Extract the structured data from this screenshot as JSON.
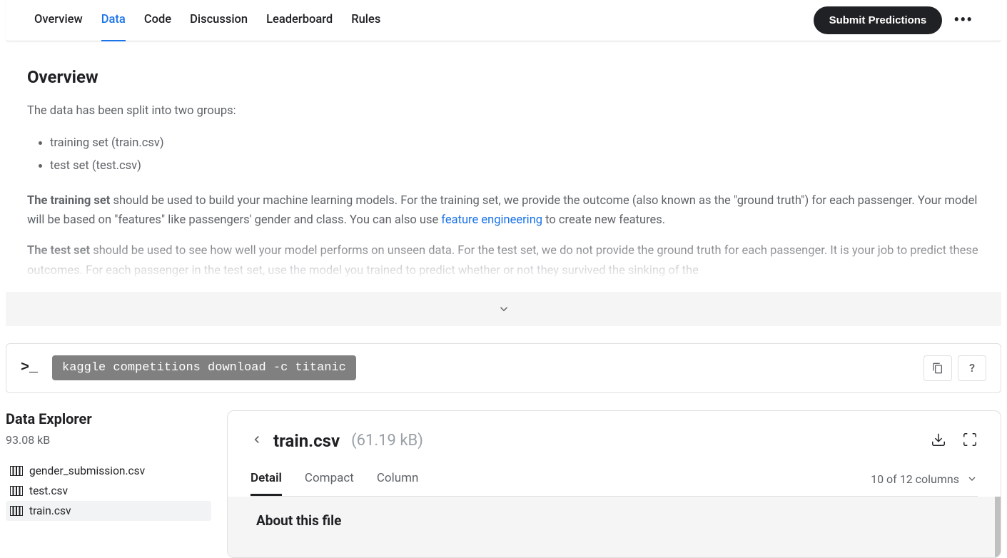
{
  "tabs": {
    "overview": "Overview",
    "data": "Data",
    "code": "Code",
    "discussion": "Discussion",
    "leaderboard": "Leaderboard",
    "rules": "Rules"
  },
  "submit_label": "Submit Predictions",
  "overview": {
    "heading": "Overview",
    "intro": "The data has been split into two groups:",
    "bullets": {
      "b0": "training set (train.csv)",
      "b1": "test set (test.csv)"
    },
    "para1_strong": "The training set",
    "para1_rest_a": " should be used to build your machine learning models. For the training set, we provide the outcome (also known as the \"ground truth\") for each passenger. Your model will be based on \"features\" like passengers' gender and class. You can also use ",
    "para1_link": "feature engineering",
    "para1_rest_b": " to create new features.",
    "para2_strong": "The test set",
    "para2_rest": " should be used to see how well your model performs on unseen data. For the test set, we do not provide the ground truth for each passenger. It is your job to predict these outcomes. For each passenger in the test set, use the model you trained to predict whether or not they survived the sinking of the"
  },
  "command": "kaggle competitions download -c titanic",
  "help_label": "?",
  "explorer": {
    "title": "Data Explorer",
    "size": "93.08 kB",
    "files": {
      "f0": "gender_submission.csv",
      "f1": "test.csv",
      "f2": "train.csv"
    }
  },
  "preview": {
    "filename": "train.csv",
    "filesize": "(61.19 kB)",
    "tabs": {
      "detail": "Detail",
      "compact": "Compact",
      "column": "Column"
    },
    "columns_label": "10 of 12 columns",
    "about_heading": "About this file"
  }
}
